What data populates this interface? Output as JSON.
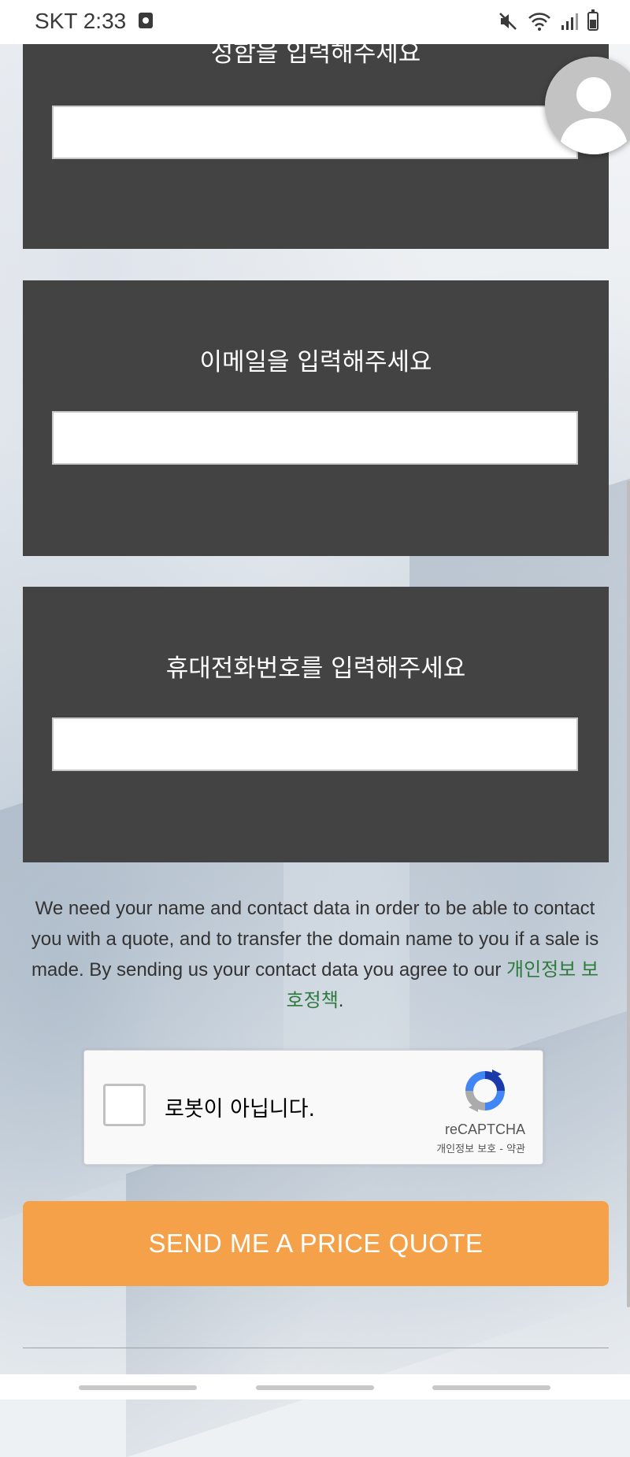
{
  "status_bar": {
    "carrier_time": "SKT 2:33",
    "icons": [
      "app-notification-icon",
      "mute-icon",
      "wifi-icon",
      "signal-icon",
      "battery-icon"
    ]
  },
  "form": {
    "name": {
      "label": "성함을 입력해주세요",
      "value": "",
      "placeholder": ""
    },
    "email": {
      "label": "이메일을 입력해주세요",
      "value": "",
      "placeholder": ""
    },
    "phone": {
      "label": "휴대전화번호를 입력해주세요",
      "value": "",
      "placeholder": ""
    }
  },
  "notice": {
    "text": "We need your name and contact data in order to be able to contact you with a quote, and to transfer the domain name to you if a sale is made. By sending us your contact data you agree to our ",
    "link": "개인정보 보호정책",
    "suffix": "."
  },
  "recaptcha": {
    "label": "로봇이 아닙니다.",
    "brand": "reCAPTCHA",
    "links": "개인정보 보호 - 약관",
    "checked": false
  },
  "submit": {
    "label": "SEND ME A PRICE QUOTE"
  },
  "colors": {
    "panel": "#434343",
    "button": "#f5a149",
    "link": "#2e7a3d"
  }
}
